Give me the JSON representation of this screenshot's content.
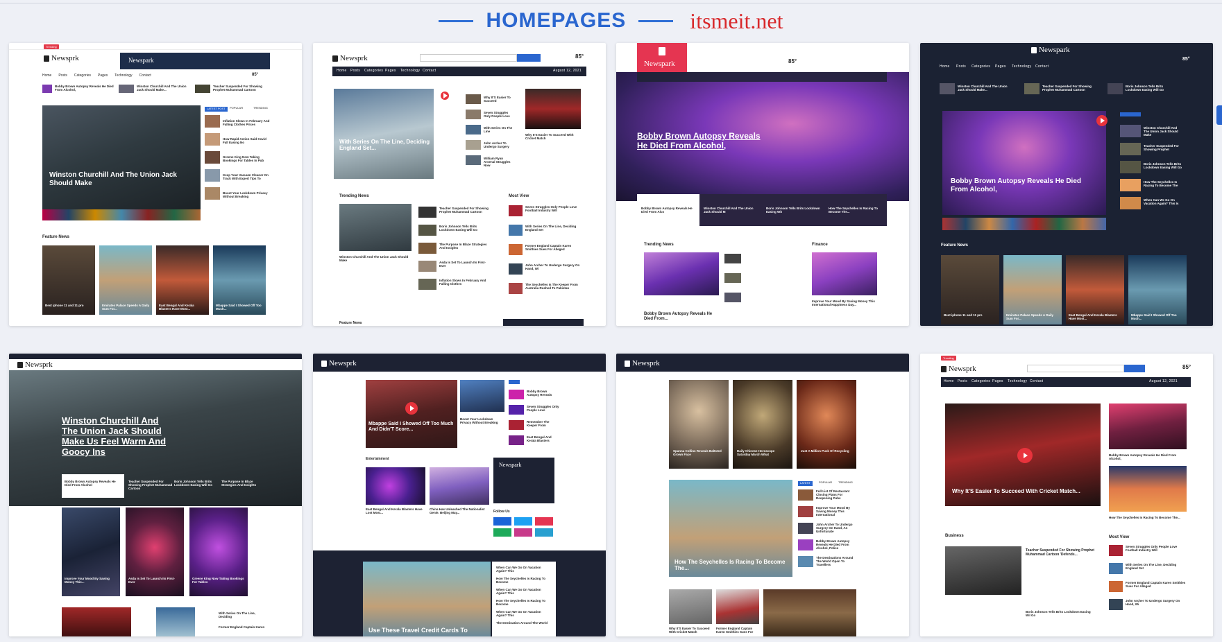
{
  "header": {
    "title": "HOMEPAGES",
    "site": "itsmeit.net"
  },
  "brand": {
    "logo_text": "Newsprk",
    "logo_text_b": "Newspark",
    "blue": "#2a66cf",
    "red": "#d8282b",
    "accent": "#e33b4b",
    "dark": "#1b2233"
  },
  "nav": [
    "Home",
    "Posts",
    "Categories",
    "Pages",
    "Technology",
    "Contact"
  ],
  "weather": "85°",
  "date": "August 12, 2021",
  "cards": {
    "c1": {
      "trending": "Trending",
      "top": [
        "Bobby Brown Autopsy Reveals He Died From Alcohol,",
        "Winston Churchill And The Union Jack Should Make...",
        "Teacher Suspended For Showing Prophet Muhammad Cartoon"
      ],
      "hero": "Winston Churchill And The Union Jack Should Make",
      "tabs": [
        "LATEST POST",
        "POPULAR",
        "TRENDING"
      ],
      "side": [
        "Inflation Slows In February And Falling Clothes Prices",
        "How Rapid Action Said Covid Fall Easing No",
        "Greene King Now Taking Bookings For Tables In Pub",
        "Keep Your Vacuum Cleaner On Track With Expert Tips To",
        "Boost Your Lockdown Privacy Without Breaking"
      ],
      "section": "Feature News",
      "features": [
        "Best iphone 11 and 11 pro",
        "Emirates Palace Speeds A Daily Sum For...",
        "East Bengal And Kerala Blasters Have Most...",
        "Mbappe Said I Showed Off Too Much..."
      ]
    },
    "c2": {
      "hero": "With Series On The Line, Deciding England Set...",
      "list": [
        "Why It'S Easier To Succeed",
        "Seven Struggles Only People Love",
        "With Series On The Line",
        "John Archer To Undergo Surgery",
        "William Ryan Arsenal Struggles Now"
      ],
      "right_hero": "Why It'S Easier To Succeed With Cricket Match",
      "trending": "Trending News",
      "trend_hero": "Winston Churchill And The Union Jack Should Make",
      "trend_list": [
        "Teacher Suspended For Showing Prophet Muhammad Cartoon",
        "Boris Johnson Tells Brits Lockdown Easing Will Go",
        "The Purpose In Blaze Strategies And Insights",
        "Asda Is Set To Launch Its First-Ever",
        "Inflation Slows In February And Falling Clothes"
      ],
      "most_view": "Most View",
      "mv_list": [
        "Seven Struggles Only People Love Football Industry Will",
        "With Series On The Line, Deciding England Set",
        "Former England Captain Karen Smithies Sues For Alleged",
        "John Archer To Undergo Surgery On Hand, Wi",
        "The Seychelles Is The Keeper From Australia Rushed To Pakistan"
      ],
      "bottom": "Feature News"
    },
    "c3": {
      "hero": "Bobby Brown Autopsy Reveals He Died From Alcohol,",
      "sub": [
        "Bobby Brown Autopsy Reveals He Died From Alco",
        "Winston Churchill And The Union Jack Should M",
        "Boris Johnson Tells Brits Lockdown Easing Wit",
        "How The Seychelles Is Racing To Become The..."
      ],
      "trending": "Trending News",
      "finance": "Finance",
      "trend_hero": "Bobby Brown Autopsy Reveals He Died From...",
      "finance_hero": "Improve Your Mood By Saving Money This International Happiness Day..."
    },
    "c4": {
      "hero": "Bobby Brown Autopsy Reveals He Died From Alcohol,",
      "top": [
        "Winston Churchill And The Union Jack Should Make...",
        "Teacher Suspended For Showing Prophet Muhammad Cartoon",
        "Boris Johnson Tells Brits Lockdown Easing Will Go"
      ],
      "side": [
        "Winston Churchill And The Union Jack Should Make",
        "Teacher Suspended For Showing Prophet",
        "Boris Johnson Tells Brits Lockdown Easing Will Go",
        "How The Seychelles Is Racing To Become The",
        "When Can We Go On Vacation Again? This Is"
      ],
      "section": "Feature News",
      "features": [
        "Best iphone 11 and 11 pro",
        "Emirates Palace Speeds A Daily Sum For...",
        "East Bengal And Kerala Blasters Have Most...",
        "Mbappe Said I Showed Off Too Much..."
      ]
    },
    "c5": {
      "hero": "Winston Churchill And The Union Jack Should Make Us Feel Warm And Goocy Ins",
      "sub": [
        "Bobby Brown Autopsy Reveals He Died From Alcohol",
        "Teacher Suspended For Showing Prophet Muhammad Cartoon",
        "Boris Johnson Tells Brits Lockdown Easing Will Go",
        "The Purpose In Blaze Strategies And Insights"
      ],
      "cards": [
        "Improve Your Mood By Saving Money This...",
        "Asda Is Set To Launch Its First-Ever",
        "Greene King Now Taking Bookings For Tables"
      ],
      "side": [
        "With Series On The Line, Deciding",
        "Former England Captain Karen"
      ]
    },
    "c6": {
      "hero": "Mbappe Said I Showed Off Too Much And Didn'T Score...",
      "side": [
        "Bobby Brown Autopsy Reveals",
        "Seven Struggles Only People Love",
        "Remember The Keeper From",
        "East Bengal And Kerala Blasters"
      ],
      "mid": "Boost Your Lockdown Privacy Without Breaking",
      "section": "Entertainment",
      "ent": [
        "East Bengal And Kerala Blasters Have Lost Most...",
        "China Has Unleashed The Nationalist Genie. Beijing May..."
      ],
      "follow": "Follow Us",
      "bottom": "Use These Travel Credit Cards To",
      "bottom_list": [
        "When Can We Go On Vacation Again? This",
        "How The Seychelles Is Racing To Become",
        "When Can We Go On Vacation Again? This",
        "How The Seychelles Is Racing To Become",
        "When Can We Go On Vacation Again? This",
        "The Destination Around The World"
      ]
    },
    "c7": {
      "cards": [
        "Spanna Collins Reveals Baltsted Grown Face",
        "Daily Chinese Horoscope Saturday March What",
        "Just A Million Puck Of Recycling"
      ],
      "hero": "How The Seychelles Is Racing To Become The...",
      "tabs": [
        "LATEST",
        "POPULAR",
        "TRENDING"
      ],
      "side": [
        "Full List Of Restaurant Closing Plans For Reopening Pubs",
        "Improve Your Mood By Saving Money This International",
        "John Archer To Undergo Surgery On Hand, An Unfortunate",
        "Bobby Brown Autopsy Reveals He Died From Alcohol, Police",
        "The Destinations Around The World Open To Travellers"
      ],
      "bottom": [
        "Why It'S Easier To Succeed With Cricket Match",
        "Former England Captain Karen Smithies Sues For"
      ]
    },
    "c8": {
      "hero": "Why It'S Easier To Succeed With Cricket Match...",
      "side": [
        "Bobby Brown Autopsy Reveals He Died From Alcohol,",
        "How The Seychelles Is Racing To Become The..."
      ],
      "section": "Business",
      "biz_hero": "Teacher Suspended For Showing Prophet Muhammad Cartoon 'Defends...",
      "biz_list": "Boris Johnson Tells Brits Lockdown Easing Wil Go",
      "most_view": "Most View",
      "mv_list": [
        "Seven Struggles Only People Love Football Industry Will",
        "With Series On The Line, Deciding England Set",
        "Former England Captain Karen Smithies Sues For Alleged",
        "John Archer To Undergo Surgery On Hand, Wi"
      ]
    }
  }
}
